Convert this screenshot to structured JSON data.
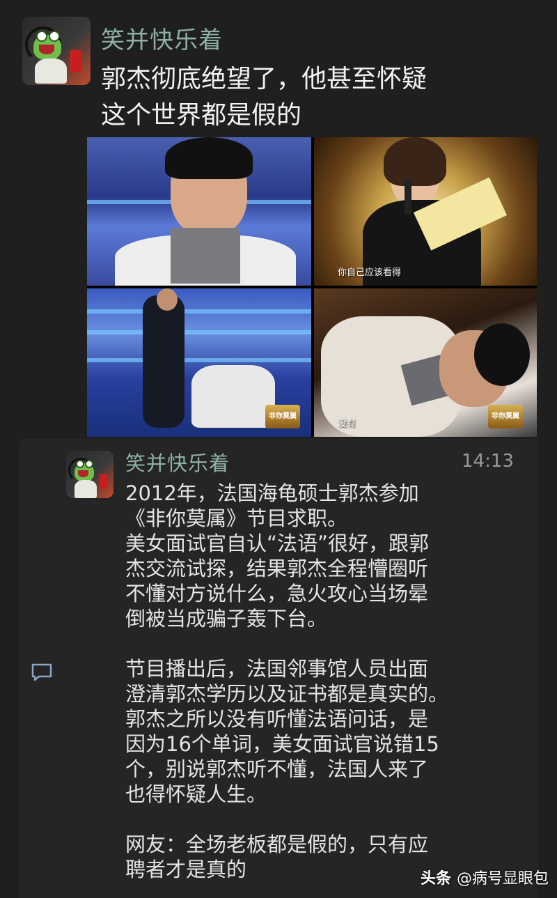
{
  "post": {
    "username": "笑并快乐着",
    "text_line1": "郭杰彻底绝望了，他甚至怀疑",
    "text_line2": "这个世界都是假的",
    "photos": [
      {
        "caption": ""
      },
      {
        "caption": "你自己应该看得"
      },
      {
        "caption": "",
        "logo_text": "非你莫属"
      },
      {
        "caption": "没有",
        "logo_text": "非你莫属"
      }
    ]
  },
  "comment_card": {
    "username": "笑并快乐着",
    "time": "14:13",
    "paragraph1": [
      "2012年，法国海龟硕士郭杰参加",
      "《非你莫属》节目求职。",
      "美女面试官自认“法语”很好，跟郭",
      "杰交流试探，结果郭杰全程懵圈听",
      "不懂对方说什么，急火攻心当场晕",
      "倒被当成骗子轰下台。"
    ],
    "paragraph2": [
      "节目播出后，法国邻事馆人员出面",
      "澄清郭杰学历以及证书都是真实的。",
      "郭杰之所以没有听懂法语问话，是",
      "因为16个单词，美女面试官说错15",
      "个，别说郭杰听不懂，法国人来了",
      "也得怀疑人生。"
    ],
    "paragraph3": [
      "网友：全场老板都是假的，只有应",
      "聘者才是真的"
    ]
  },
  "watermark": {
    "brand": "头条",
    "handle": "@病号显眼包"
  },
  "icons": {
    "comment": "comment-bubble-icon"
  }
}
